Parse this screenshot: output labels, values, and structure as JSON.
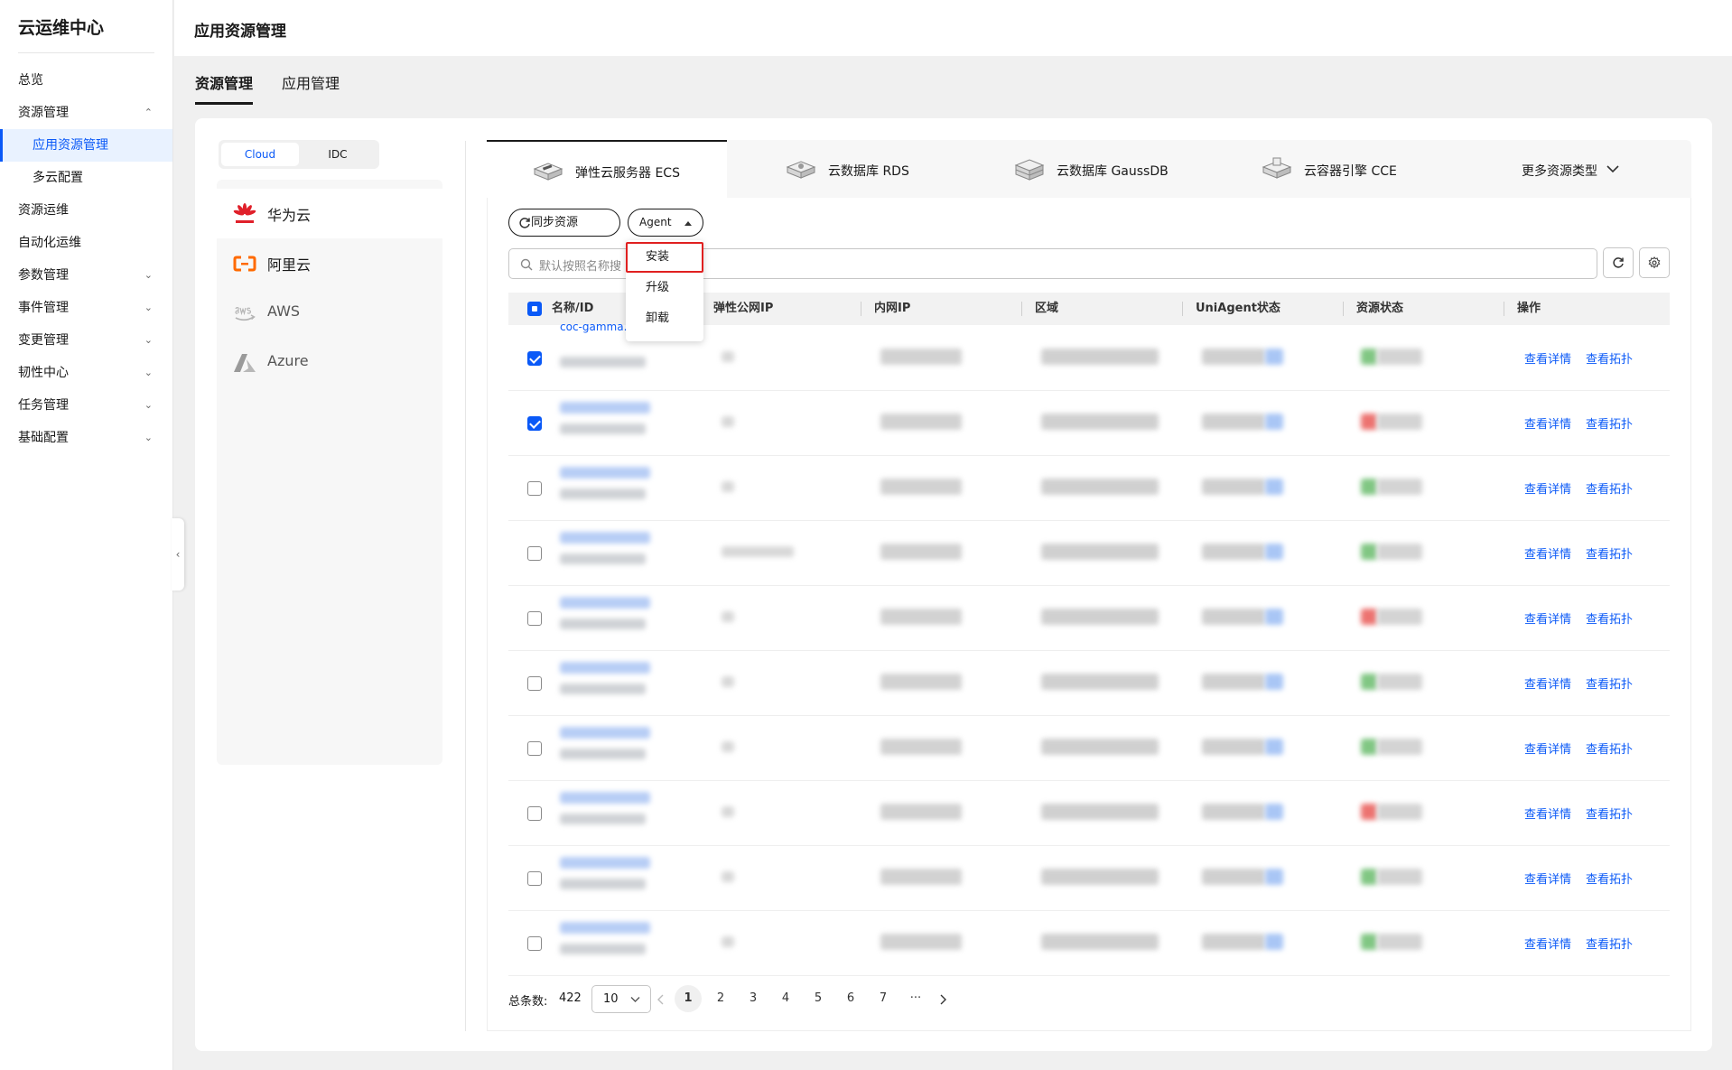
{
  "sidebar": {
    "title": "云运维中心",
    "items": [
      {
        "label": "总览",
        "chevron": ""
      },
      {
        "label": "资源管理",
        "chevron": "⌃"
      },
      {
        "label": "应用资源管理",
        "chevron": ""
      },
      {
        "label": "多云配置",
        "chevron": ""
      },
      {
        "label": "资源运维",
        "chevron": ""
      },
      {
        "label": "自动化运维",
        "chevron": ""
      },
      {
        "label": "参数管理",
        "chevron": "⌄"
      },
      {
        "label": "事件管理",
        "chevron": "⌄"
      },
      {
        "label": "变更管理",
        "chevron": "⌄"
      },
      {
        "label": "韧性中心",
        "chevron": "⌄"
      },
      {
        "label": "任务管理",
        "chevron": "⌄"
      },
      {
        "label": "基础配置",
        "chevron": "⌄"
      }
    ],
    "collapse_glyph": "‹"
  },
  "header": {
    "title": "应用资源管理"
  },
  "page_tabs": [
    {
      "label": "资源管理"
    },
    {
      "label": "应用管理"
    }
  ],
  "segment": {
    "cloud": "Cloud",
    "idc": "IDC"
  },
  "providers": [
    {
      "label": "华为云",
      "icon": "huawei-icon"
    },
    {
      "label": "阿里云",
      "icon": "aliyun-icon"
    },
    {
      "label": "AWS",
      "icon": "aws-icon"
    },
    {
      "label": "Azure",
      "icon": "azure-icon"
    }
  ],
  "resource_tabs": [
    {
      "label": "弹性云服务器 ECS"
    },
    {
      "label": "云数据库 RDS"
    },
    {
      "label": "云数据库 GaussDB"
    },
    {
      "label": "云容器引擎 CCE"
    },
    {
      "label": "更多资源类型"
    }
  ],
  "toolbar": {
    "sync_label": "同步资源",
    "agent_label": "Agent",
    "search_placeholder": "默认按照名称搜"
  },
  "agent_menu": [
    {
      "label": "安装"
    },
    {
      "label": "升级"
    },
    {
      "label": "卸载"
    }
  ],
  "table": {
    "columns": [
      "名称/ID",
      "弹性公网IP",
      "内网IP",
      "区域",
      "UniAgent状态",
      "资源状态",
      "操作"
    ],
    "first_row_name": "coc-gamma...",
    "op_detail": "查看详情",
    "op_topo": "查看拓扑",
    "rows": [
      {
        "checked": true,
        "status": "green"
      },
      {
        "checked": true,
        "status": "red"
      },
      {
        "checked": false,
        "status": "green"
      },
      {
        "checked": false,
        "status": "green"
      },
      {
        "checked": false,
        "status": "red"
      },
      {
        "checked": false,
        "status": "green"
      },
      {
        "checked": false,
        "status": "green"
      },
      {
        "checked": false,
        "status": "red"
      },
      {
        "checked": false,
        "status": "green"
      },
      {
        "checked": false,
        "status": "green"
      }
    ]
  },
  "pagination": {
    "total_label": "总条数:",
    "total": "422",
    "page_size": "10",
    "pages": [
      "1",
      "2",
      "3",
      "4",
      "5",
      "6",
      "7",
      "···"
    ],
    "current": "1"
  },
  "colors": {
    "accent": "#0a59f7",
    "status_green": "#4caf50",
    "status_red": "#e53935",
    "highlight": "#e02020"
  }
}
